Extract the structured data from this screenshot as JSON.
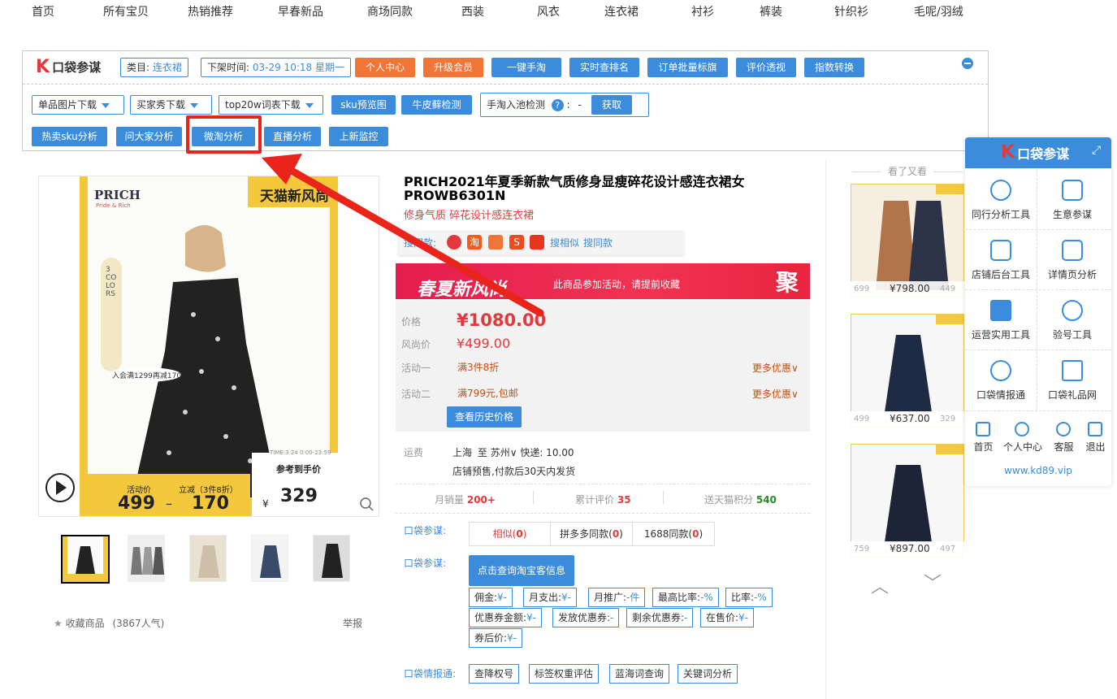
{
  "topnav": [
    "首页",
    "所有宝贝",
    "热销推荐",
    "早春新品",
    "商场同款",
    "西装",
    "风衣",
    "连衣裙",
    "衬衫",
    "裤装",
    "针织衫",
    "毛呢/羽绒"
  ],
  "toolbar": {
    "logo_text": "口袋参谋",
    "category_label": "类目:",
    "category_value": "连衣裙",
    "offshelf_label": "下架时间:",
    "offshelf_value": "03-29 10:18 星期一",
    "row1_buttons": [
      "个人中心",
      "升级会员",
      "一键手淘",
      "实时查排名",
      "订单批量标旗",
      "评价透视",
      "指数转换"
    ],
    "row2": {
      "dropdowns": [
        "单品图片下载",
        "买家秀下载",
        "top20w词表下载"
      ],
      "buttons": [
        "sku预览图",
        "牛皮藓检测"
      ],
      "pool_label": "手淘入池检测",
      "pool_value": "-",
      "fetch": "获取"
    },
    "row3_buttons": [
      "热卖sku分析",
      "问大家分析",
      "微淘分析",
      "直播分析",
      "上新监控"
    ]
  },
  "product": {
    "title": "PRICH2021年夏季新款气质修身显瘦碎花设计感连衣裙女PROWB6301N",
    "subtitle": "修身气质 碎花设计感连衣裙",
    "image": {
      "brand": "PRICH",
      "brand_sub": "Pride & Rich",
      "tmall_tag": "天猫新风尚",
      "colors_text": "3 COLORS",
      "promo": "入会满1299再减170",
      "time": "TIME:3.24 0:00-23:59",
      "ref_label": "参考到手价",
      "ref_price": "329",
      "price_label1": "活动价",
      "price1": "499",
      "price_label2": "立减（3件8折）",
      "price2": "170",
      "currency": "¥"
    },
    "search_label": "搜同款:",
    "search_links": [
      "搜相似",
      "搜同款"
    ],
    "banner_left": "春夏新风尚",
    "banner_mid": "此商品参加活动，请提前收藏",
    "banner_right": "聚",
    "price_label": "价格",
    "price": "¥1080.00",
    "fashion_label": "风尚价",
    "fashion_price": "¥499.00",
    "act1_label": "活动一",
    "act1": "满3件8折",
    "act1_more": "更多优惠",
    "act2_label": "活动二",
    "act2": "满799元,包邮",
    "act2_more": "更多优惠",
    "history_btn": "查看历史价格",
    "ship_label": "运费",
    "ship_from": "上海",
    "ship_to_word": "至",
    "ship_to": "苏州",
    "ship_fee": "快递: 10.00",
    "presale": "店铺预售,付款后30天内发货",
    "stats": {
      "sales_label": "月销量",
      "sales": "200+",
      "reviews_label": "累计评价",
      "reviews": "35",
      "points_label": "送天猫积分",
      "points": "540"
    },
    "kd_label1": "口袋参谋:",
    "same": [
      {
        "label": "相似(",
        "num": "0",
        "end": ")"
      },
      {
        "label": "拼多多同款(",
        "num": "0",
        "end": ")"
      },
      {
        "label": "1688同款(",
        "num": "0",
        "end": ")"
      }
    ],
    "kd_label2": "口袋参谋:",
    "query_btn": "点击查询淘宝客信息",
    "tk": [
      {
        "k": "佣金:",
        "v": "¥-"
      },
      {
        "k": "月支出:",
        "v": "¥-"
      },
      {
        "k": "月推广:",
        "v": "-件"
      },
      {
        "k": "最高比率:",
        "v": "-%"
      },
      {
        "k": "比率:",
        "v": "-%"
      },
      {
        "k": "优惠券金额:",
        "v": "¥-"
      },
      {
        "k": "发放优惠券:",
        "v": "-"
      },
      {
        "k": "剩余优惠券:",
        "v": "-"
      },
      {
        "k": "在售价:",
        "v": "¥-"
      },
      {
        "k": "券后价:",
        "v": "¥-"
      }
    ],
    "intel_label": "口袋情报通:",
    "intel_buttons": [
      "查降权号",
      "标签权重评估",
      "蓝海词查询",
      "关键词分析"
    ],
    "collect": "收藏商品",
    "collect_count": "(3867人气)",
    "report": "举报"
  },
  "related": {
    "title": "看了又看",
    "items": [
      {
        "price": "¥798.00",
        "old": "699",
        "extra": "449"
      },
      {
        "price": "¥637.00",
        "old": "499",
        "extra": "329"
      },
      {
        "price": "¥897.00",
        "old": "759",
        "extra": "497"
      }
    ],
    "up": "︿",
    "down": "﹀"
  },
  "panel": {
    "logo_text": "口袋参谋",
    "items": [
      {
        "label": "同行分析工具",
        "icon": "peers-icon"
      },
      {
        "label": "生意参谋",
        "icon": "compass-icon"
      },
      {
        "label": "店铺后台工具",
        "icon": "shop-icon"
      },
      {
        "label": "详情页分析",
        "icon": "store-icon"
      },
      {
        "label": "运营实用工具",
        "icon": "chart-icon"
      },
      {
        "label": "验号工具",
        "icon": "verify-icon"
      },
      {
        "label": "口袋情报通",
        "icon": "radar-icon"
      },
      {
        "label": "口袋礼品网",
        "icon": "gift-icon"
      }
    ],
    "footer": [
      "首页",
      "个人中心",
      "客服",
      "退出"
    ],
    "url": "www.kd89.vip"
  },
  "colors": {
    "accent": "#3b8ddb",
    "orange": "#f07637",
    "red": "#e4393c",
    "highlight": "#e8241b"
  }
}
